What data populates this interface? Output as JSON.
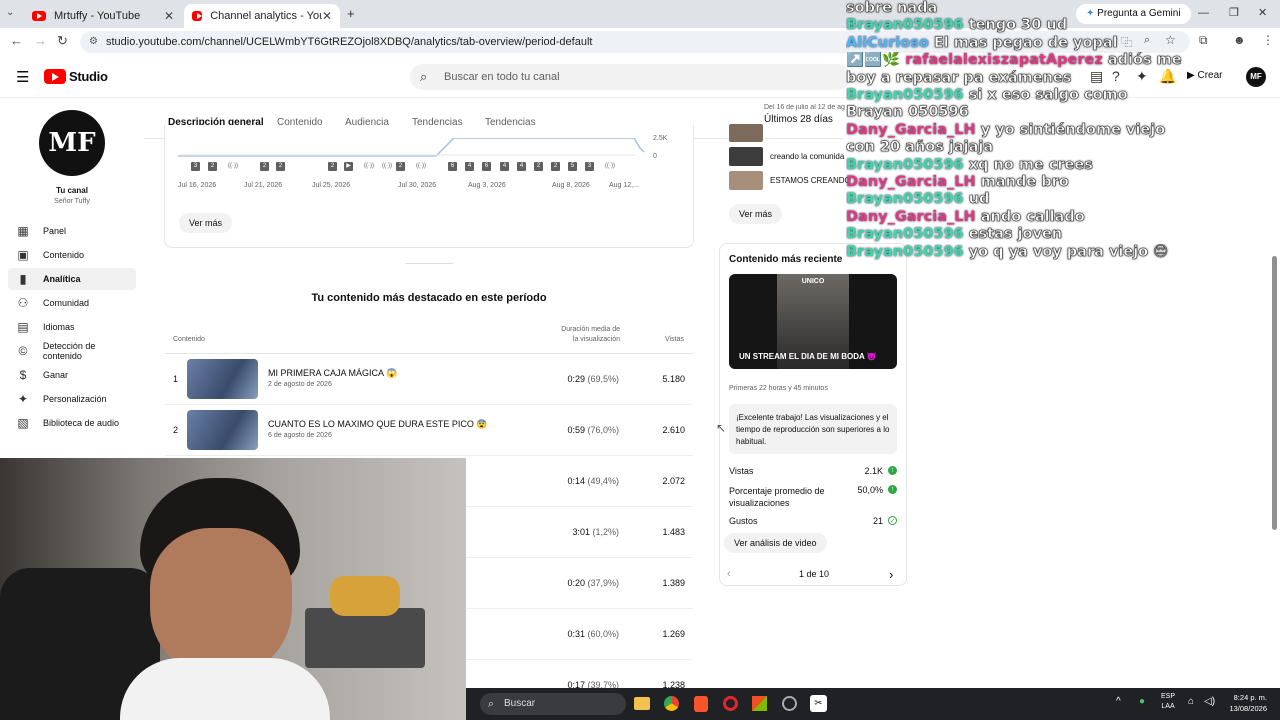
{
  "browser": {
    "tabs": [
      {
        "title": "Mrtuffy - YouTube",
        "active": false
      },
      {
        "title": "Channel analytics - YouTube St",
        "active": true
      }
    ],
    "new_tab": "+",
    "gemini_label": "Pregunta a Gemini",
    "url": "studio.youtube.com/channel/UCELWmbYT6GtREZOjol8XDBQ/analytics/tab-overview/period-default"
  },
  "studio": {
    "logo_text": "Studio",
    "search_placeholder": "Buscar en todo tu canal",
    "create_label": "Crear",
    "avatar_text": "MF"
  },
  "sidebar": {
    "channel_avatar_text": "MF",
    "channel_label": "Tu canal",
    "channel_name": "Señor Tuffy",
    "items": [
      {
        "label": "Panel",
        "icon": "grid-icon",
        "glyph": "▦"
      },
      {
        "label": "Contenido",
        "icon": "content-icon",
        "glyph": "▣"
      },
      {
        "label": "Analítica",
        "icon": "analytics-icon",
        "glyph": "▮"
      },
      {
        "label": "Comunidad",
        "icon": "community-icon",
        "glyph": "⚇"
      },
      {
        "label": "Idiomas",
        "icon": "subtitles-icon",
        "glyph": "▤"
      },
      {
        "label": "Detección de contenido",
        "icon": "copyright-icon",
        "glyph": "©"
      },
      {
        "label": "Ganar",
        "icon": "dollar-icon",
        "glyph": "$"
      },
      {
        "label": "Personalización",
        "icon": "magic-wand-icon",
        "glyph": "✦"
      },
      {
        "label": "Biblioteca de audio",
        "icon": "audio-library-icon",
        "glyph": "▧"
      }
    ]
  },
  "analytics": {
    "tabs": [
      "Descripción general",
      "Contenido",
      "Audiencia",
      "Tendencias",
      "Tendencias"
    ],
    "period_caption": "Del 16 de julio al 12 de ag",
    "period_label": "Últimos 28 días",
    "chart": {
      "y_top": "2.5K",
      "y_zero": "0",
      "x_labels": [
        "Jul 16, 2026",
        "Jul 21, 2026",
        "Jul 25, 2026",
        "Jul 30, 2026",
        "Aug 3, 2026",
        "Aug 8, 2026",
        "Aug 12,..."
      ],
      "markers": [
        "3",
        "2",
        "((·))",
        "2",
        "2",
        "2",
        "▶",
        "((·))",
        "((·))",
        "2",
        "((·))",
        "6",
        "4",
        "6",
        "4",
        "4",
        "2",
        "2",
        "5",
        "3",
        "((·))"
      ]
    },
    "see_more": "Ver más",
    "top_content_title": "Tu contenido más destacado en este período",
    "columns": {
      "content": "Contenido",
      "duration": "Duración media de la visualización",
      "views": "Vistas"
    },
    "rows": [
      {
        "rank": "1",
        "title": "MI PRIMERA CAJA MÁGICA 😱",
        "date": "2 de agosto de 2026",
        "dur": "0:29",
        "pct": "(69,5%)",
        "views": "5.180"
      },
      {
        "rank": "2",
        "title": "CUANTO ES LO MAXIMO QUE DURA ESTE PICO 😨",
        "date": "6 de agosto de 2026",
        "dur": "0:59",
        "pct": "(76,0%)",
        "views": "2.610"
      },
      {
        "rank": "",
        "title": "",
        "date": "",
        "dur": "0:14",
        "pct": "(49,4%)",
        "views": "2.072"
      },
      {
        "rank": "",
        "title": "",
        "date": "",
        "dur": "3:01",
        "pct": "(1,2%)",
        "views": "1.483"
      },
      {
        "rank": "",
        "title": "",
        "date": "",
        "dur": "0:20",
        "pct": "(37,9%)",
        "views": "1.389"
      },
      {
        "rank": "",
        "title": "",
        "date": "",
        "dur": "0:31",
        "pct": "(60,0%)",
        "views": "1.269"
      },
      {
        "rank": "",
        "title": "",
        "date": "",
        "dur": "0:17",
        "pct": "(39,7%)",
        "views": "1.238"
      }
    ]
  },
  "right_panel": {
    "list_items": [
      "creando la comunida",
      "ESTAMOS CREANDO"
    ],
    "see_more": "Ver más",
    "latest_title": "Contenido más reciente",
    "thumb_top_text": "UNICO",
    "thumb_caption": "UN STREAM EL DIA DE MI BODA 😈",
    "first_hours": "Primeras 22 horas y 45 minutos",
    "praise": "¡Excelente trabajo! Las visualizaciones y el tiempo de reproducción son superiores a lo habitual.",
    "stats": [
      {
        "label": "Vistas",
        "value": "2.1K"
      },
      {
        "label": "Porcentaje promedio de visualizaciones",
        "value": "50,0%"
      },
      {
        "label": "Gustos",
        "value": "21"
      }
    ],
    "video_analysis_btn": "Ver análisis de video",
    "pager": "1 de 10"
  },
  "chat": [
    {
      "user": "",
      "msg": "sobre nada"
    },
    {
      "user": "Brayan050596",
      "msg": "tengo 30 ud"
    },
    {
      "user": "AliCurioso",
      "msg": "El mas pegao de yopal"
    },
    {
      "user": "rafaelalexiszapatAperez",
      "msg": "adiós me",
      "badges": "↗️🆒🌿"
    },
    {
      "user": "",
      "msg": "boy a repasar pa exámenes"
    },
    {
      "user": "Brayan050596",
      "msg": "si x eso salgo como"
    },
    {
      "user": "",
      "msg": "Brayan 050596"
    },
    {
      "user": "Dany_Garcia_LH",
      "msg": "y yo sintiéndome viejo"
    },
    {
      "user": "",
      "msg": "con 20 años jajaja"
    },
    {
      "user": "Brayan050596",
      "msg": "xq no me crees"
    },
    {
      "user": "Dany_Garcia_LH",
      "msg": "mande bro"
    },
    {
      "user": "Brayan050596",
      "msg": "ud"
    },
    {
      "user": "Dany_Garcia_LH",
      "msg": "ando callado"
    },
    {
      "user": "Brayan050596",
      "msg": "estas joven"
    },
    {
      "user": "Brayan050596",
      "msg": "yo q ya voy para viejo 😔"
    }
  ],
  "taskbar": {
    "search_label": "Buscar",
    "lang_top": "ESP",
    "lang_bottom": "LAA",
    "time": "8:24 p. m.",
    "date": "13/08/2026"
  },
  "colors": {
    "accent_red": "#ff0000",
    "chat_user_teal": "#3fd7a4",
    "chat_user_pink": "#e03a7a",
    "success_green": "#2ba640"
  }
}
